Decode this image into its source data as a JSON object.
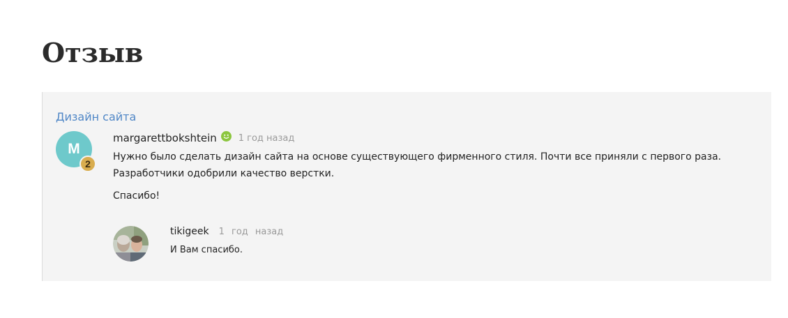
{
  "page": {
    "title": "Отзыв"
  },
  "review": {
    "category": "Дизайн сайта",
    "author": {
      "initial": "М",
      "name": "margarettbokshtein",
      "level": "2",
      "status_icon": "smiley-icon"
    },
    "time": "1 год назад",
    "text": "Нужно было сделать дизайн сайта на основе существующего фирменного стиля. Почти все приняли с первого раза. Разработчики одобрили качество верстки.",
    "thanks": "Спасибо!",
    "reply": {
      "author": "tikigeek",
      "time": "1 год назад",
      "text": "И Вам спасибо.",
      "avatar_icon": "user-photo"
    }
  },
  "colors": {
    "link": "#4f86c6",
    "avatar_bg": "#6ec9cb",
    "badge": "#d9ad4f",
    "smiley": "#8cc63f",
    "card_bg": "#f4f4f4",
    "meta": "#9a9a9a"
  }
}
